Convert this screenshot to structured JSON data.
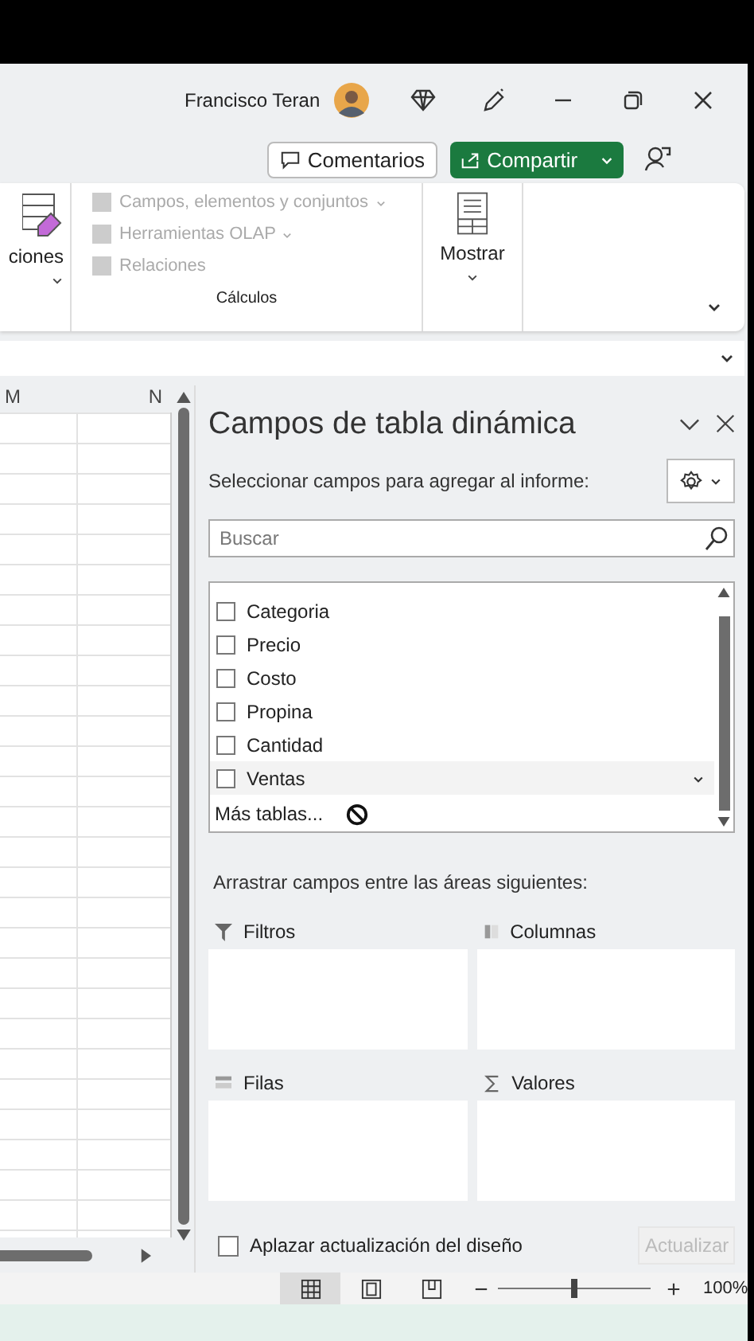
{
  "title_bar": {
    "user_name": "Francisco Teran"
  },
  "actions": {
    "comments": "Comentarios",
    "share": "Compartir"
  },
  "ribbon": {
    "partial_button": "ciones",
    "calc_items": [
      {
        "label": "Campos, elementos y conjuntos",
        "disabled": true,
        "dropdown": true
      },
      {
        "label": "Herramientas OLAP",
        "disabled": true,
        "dropdown": true
      },
      {
        "label": "Relaciones",
        "disabled": true,
        "dropdown": false
      }
    ],
    "calc_group": "Cálculos",
    "show_button": "Mostrar"
  },
  "sheet": {
    "columns": [
      "M",
      "N"
    ]
  },
  "pivot_pane": {
    "title": "Campos de tabla dinámica",
    "subtitle": "Seleccionar campos para agregar al informe:",
    "search": {
      "placeholder": "Buscar"
    },
    "fields": [
      {
        "label": "Categoria",
        "checked": false
      },
      {
        "label": "Precio",
        "checked": false
      },
      {
        "label": "Costo",
        "checked": false
      },
      {
        "label": "Propina",
        "checked": false
      },
      {
        "label": "Cantidad",
        "checked": false
      },
      {
        "label": "Ventas",
        "checked": false
      }
    ],
    "more_tables": "Más tablas...",
    "areas_hint": "Arrastrar campos entre las áreas siguientes:",
    "areas": [
      {
        "kind": "filter",
        "label": "Filtros"
      },
      {
        "kind": "columns",
        "label": "Columnas"
      },
      {
        "kind": "rows",
        "label": "Filas"
      },
      {
        "kind": "values",
        "label": "Valores"
      }
    ],
    "defer": {
      "label": "Aplazar actualización del diseño",
      "checked": false
    },
    "update_button": {
      "label": "Actualizar",
      "disabled": true
    }
  },
  "status_bar": {
    "views": [
      {
        "kind": "normal",
        "selected": true
      },
      {
        "kind": "page_layout",
        "selected": false
      },
      {
        "kind": "page_break",
        "selected": false
      }
    ],
    "zoom": {
      "level": 0.5,
      "reading": "100%"
    }
  }
}
